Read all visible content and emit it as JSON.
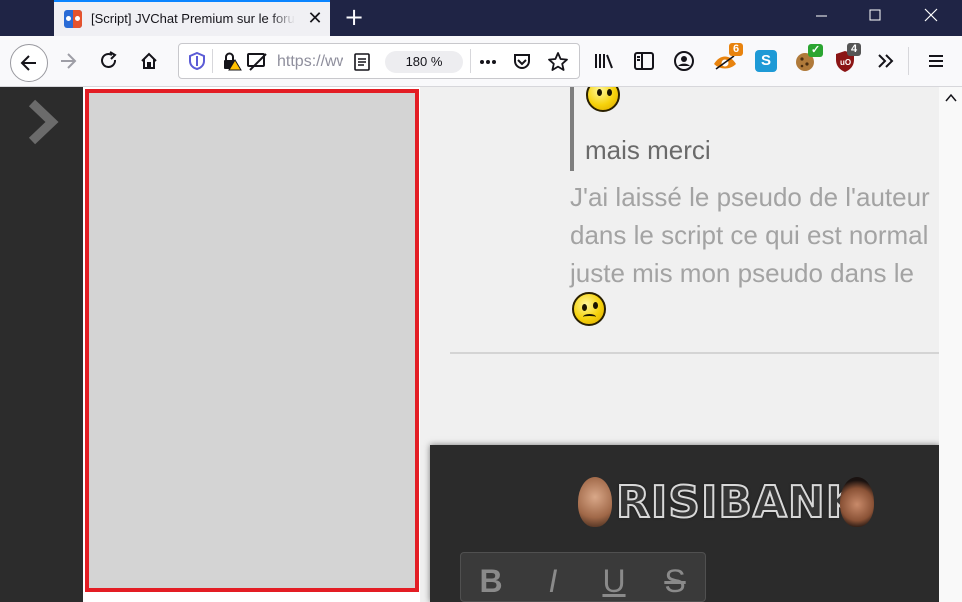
{
  "browser": {
    "tab": {
      "title": "[Script] JVChat Premium sur le forum"
    },
    "url": "https://www.jeuxvideo.com",
    "zoom": "180 %",
    "extensions": [
      {
        "name": "extension-badge-6",
        "badge": "6",
        "badge_color": "#e8830e"
      },
      {
        "name": "extension-check",
        "badge": "✓",
        "badge_color": "#2ba531"
      },
      {
        "name": "ublock",
        "badge": "4",
        "badge_color": "#555555"
      }
    ]
  },
  "content": {
    "quote": "mais merci",
    "message_lines": [
      "J'ai laissé le pseudo de l'auteur",
      "dans le script ce qui est normal",
      "juste mis mon pseudo dans le"
    ]
  },
  "editor": {
    "logo_text": "RISIBANK",
    "format_buttons": [
      "B",
      "I",
      "U",
      "S"
    ]
  },
  "colors": {
    "titlebar": "#1f2445",
    "accent": "#0a84ff",
    "selection_border": "#e31d24",
    "editor_bg": "#2b2b2b"
  }
}
